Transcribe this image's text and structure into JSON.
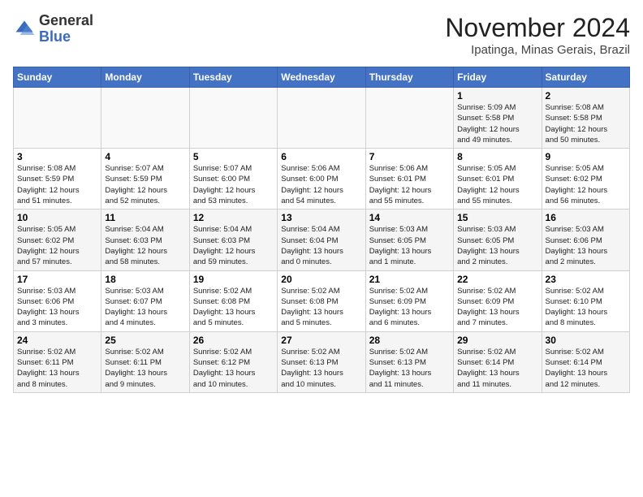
{
  "header": {
    "logo_general": "General",
    "logo_blue": "Blue",
    "month_title": "November 2024",
    "location": "Ipatinga, Minas Gerais, Brazil"
  },
  "weekdays": [
    "Sunday",
    "Monday",
    "Tuesday",
    "Wednesday",
    "Thursday",
    "Friday",
    "Saturday"
  ],
  "weeks": [
    [
      {
        "day": "",
        "info": ""
      },
      {
        "day": "",
        "info": ""
      },
      {
        "day": "",
        "info": ""
      },
      {
        "day": "",
        "info": ""
      },
      {
        "day": "",
        "info": ""
      },
      {
        "day": "1",
        "info": "Sunrise: 5:09 AM\nSunset: 5:58 PM\nDaylight: 12 hours\nand 49 minutes."
      },
      {
        "day": "2",
        "info": "Sunrise: 5:08 AM\nSunset: 5:58 PM\nDaylight: 12 hours\nand 50 minutes."
      }
    ],
    [
      {
        "day": "3",
        "info": "Sunrise: 5:08 AM\nSunset: 5:59 PM\nDaylight: 12 hours\nand 51 minutes."
      },
      {
        "day": "4",
        "info": "Sunrise: 5:07 AM\nSunset: 5:59 PM\nDaylight: 12 hours\nand 52 minutes."
      },
      {
        "day": "5",
        "info": "Sunrise: 5:07 AM\nSunset: 6:00 PM\nDaylight: 12 hours\nand 53 minutes."
      },
      {
        "day": "6",
        "info": "Sunrise: 5:06 AM\nSunset: 6:00 PM\nDaylight: 12 hours\nand 54 minutes."
      },
      {
        "day": "7",
        "info": "Sunrise: 5:06 AM\nSunset: 6:01 PM\nDaylight: 12 hours\nand 55 minutes."
      },
      {
        "day": "8",
        "info": "Sunrise: 5:05 AM\nSunset: 6:01 PM\nDaylight: 12 hours\nand 55 minutes."
      },
      {
        "day": "9",
        "info": "Sunrise: 5:05 AM\nSunset: 6:02 PM\nDaylight: 12 hours\nand 56 minutes."
      }
    ],
    [
      {
        "day": "10",
        "info": "Sunrise: 5:05 AM\nSunset: 6:02 PM\nDaylight: 12 hours\nand 57 minutes."
      },
      {
        "day": "11",
        "info": "Sunrise: 5:04 AM\nSunset: 6:03 PM\nDaylight: 12 hours\nand 58 minutes."
      },
      {
        "day": "12",
        "info": "Sunrise: 5:04 AM\nSunset: 6:03 PM\nDaylight: 12 hours\nand 59 minutes."
      },
      {
        "day": "13",
        "info": "Sunrise: 5:04 AM\nSunset: 6:04 PM\nDaylight: 13 hours\nand 0 minutes."
      },
      {
        "day": "14",
        "info": "Sunrise: 5:03 AM\nSunset: 6:05 PM\nDaylight: 13 hours\nand 1 minute."
      },
      {
        "day": "15",
        "info": "Sunrise: 5:03 AM\nSunset: 6:05 PM\nDaylight: 13 hours\nand 2 minutes."
      },
      {
        "day": "16",
        "info": "Sunrise: 5:03 AM\nSunset: 6:06 PM\nDaylight: 13 hours\nand 2 minutes."
      }
    ],
    [
      {
        "day": "17",
        "info": "Sunrise: 5:03 AM\nSunset: 6:06 PM\nDaylight: 13 hours\nand 3 minutes."
      },
      {
        "day": "18",
        "info": "Sunrise: 5:03 AM\nSunset: 6:07 PM\nDaylight: 13 hours\nand 4 minutes."
      },
      {
        "day": "19",
        "info": "Sunrise: 5:02 AM\nSunset: 6:08 PM\nDaylight: 13 hours\nand 5 minutes."
      },
      {
        "day": "20",
        "info": "Sunrise: 5:02 AM\nSunset: 6:08 PM\nDaylight: 13 hours\nand 5 minutes."
      },
      {
        "day": "21",
        "info": "Sunrise: 5:02 AM\nSunset: 6:09 PM\nDaylight: 13 hours\nand 6 minutes."
      },
      {
        "day": "22",
        "info": "Sunrise: 5:02 AM\nSunset: 6:09 PM\nDaylight: 13 hours\nand 7 minutes."
      },
      {
        "day": "23",
        "info": "Sunrise: 5:02 AM\nSunset: 6:10 PM\nDaylight: 13 hours\nand 8 minutes."
      }
    ],
    [
      {
        "day": "24",
        "info": "Sunrise: 5:02 AM\nSunset: 6:11 PM\nDaylight: 13 hours\nand 8 minutes."
      },
      {
        "day": "25",
        "info": "Sunrise: 5:02 AM\nSunset: 6:11 PM\nDaylight: 13 hours\nand 9 minutes."
      },
      {
        "day": "26",
        "info": "Sunrise: 5:02 AM\nSunset: 6:12 PM\nDaylight: 13 hours\nand 10 minutes."
      },
      {
        "day": "27",
        "info": "Sunrise: 5:02 AM\nSunset: 6:13 PM\nDaylight: 13 hours\nand 10 minutes."
      },
      {
        "day": "28",
        "info": "Sunrise: 5:02 AM\nSunset: 6:13 PM\nDaylight: 13 hours\nand 11 minutes."
      },
      {
        "day": "29",
        "info": "Sunrise: 5:02 AM\nSunset: 6:14 PM\nDaylight: 13 hours\nand 11 minutes."
      },
      {
        "day": "30",
        "info": "Sunrise: 5:02 AM\nSunset: 6:14 PM\nDaylight: 13 hours\nand 12 minutes."
      }
    ]
  ]
}
